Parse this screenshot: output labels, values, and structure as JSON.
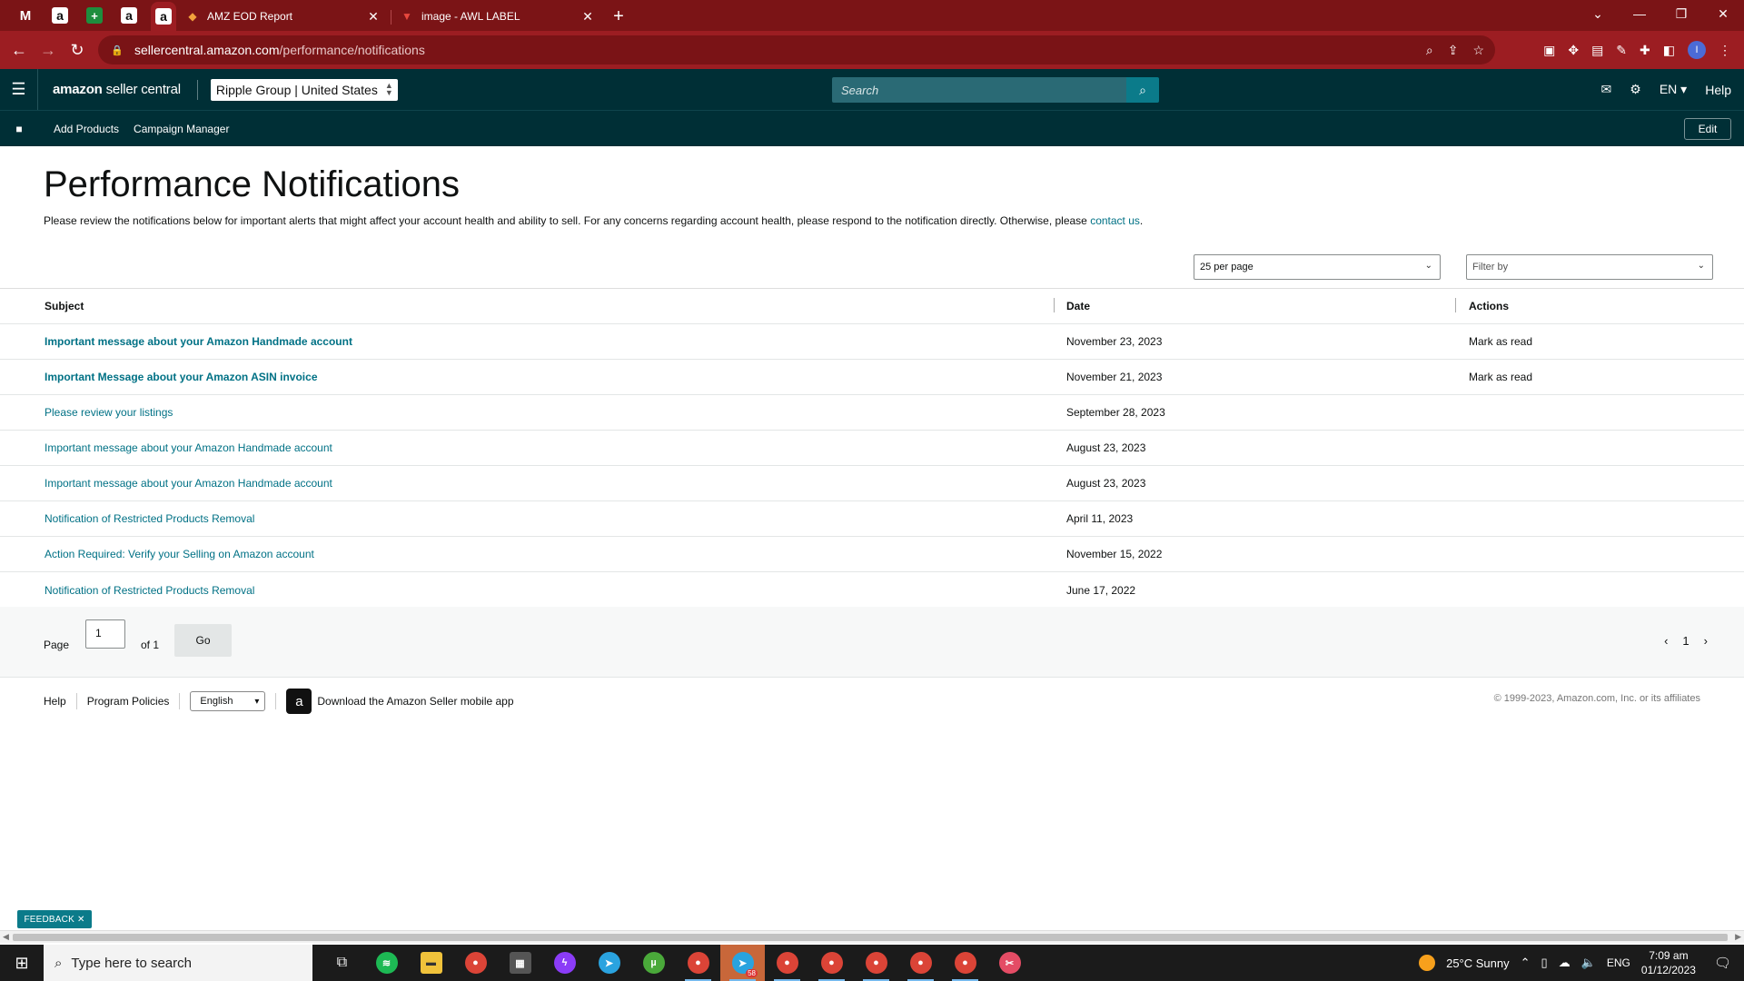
{
  "browser": {
    "pinned_tabs": [
      "gmail",
      "amazon",
      "sheets",
      "amazon",
      "amazon"
    ],
    "tabs": [
      {
        "title": "AMZ EOD Report"
      },
      {
        "title": "image - AWL LABEL"
      }
    ],
    "url_host": "sellercentral.amazon.com",
    "url_path": "/performance/notifications"
  },
  "header": {
    "logo_brand": "amazon",
    "logo_product": "seller central",
    "account": "Ripple Group",
    "marketplace": "United States",
    "search_placeholder": "Search",
    "language": "EN",
    "help": "Help"
  },
  "bookmarks": {
    "items": [
      "Add Products",
      "Campaign Manager"
    ],
    "edit": "Edit"
  },
  "page": {
    "title": "Performance Notifications",
    "intro": "Please review the notifications below for important alerts that might affect your account health and ability to sell. For any concerns regarding account health, please respond to the notification directly. Otherwise, please ",
    "intro_link": "contact us",
    "intro_end": ".",
    "per_page": "25 per page",
    "filter_placeholder": "Filter by"
  },
  "table": {
    "headers": {
      "subject": "Subject",
      "date": "Date",
      "actions": "Actions"
    },
    "rows": [
      {
        "subject": "Important message about your Amazon Handmade account",
        "date": "November 23, 2023",
        "action": "Mark as read"
      },
      {
        "subject": "Important Message about your Amazon ASIN invoice",
        "date": "November 21, 2023",
        "action": "Mark as read"
      },
      {
        "subject": "Please review your listings",
        "date": "September 28, 2023",
        "action": ""
      },
      {
        "subject": "Important message about your Amazon Handmade account",
        "date": "August 23, 2023",
        "action": ""
      },
      {
        "subject": "Important message about your Amazon Handmade account",
        "date": "August 23, 2023",
        "action": ""
      },
      {
        "subject": "Notification of Restricted Products Removal",
        "date": "April 11, 2023",
        "action": ""
      },
      {
        "subject": "Action Required: Verify your Selling on Amazon account",
        "date": "November 15, 2022",
        "action": ""
      },
      {
        "subject": "Notification of Restricted Products Removal",
        "date": "June 17, 2022",
        "action": ""
      }
    ]
  },
  "pagination": {
    "page_label": "Page",
    "page_value": "1",
    "of_label": "of 1",
    "go": "Go",
    "current": "1"
  },
  "footer": {
    "help": "Help",
    "policies": "Program Policies",
    "language": "English",
    "app": "Download the Amazon Seller mobile app",
    "copyright": "© 1999-2023, Amazon.com, Inc. or its affiliates"
  },
  "feedback": "FEEDBACK",
  "taskbar": {
    "search": "Type here to search",
    "telegram_badge": "58",
    "weather": "25°C  Sunny",
    "lang": "ENG",
    "time": "7:09 am",
    "date": "01/12/2023"
  },
  "colors": {
    "browser_frame": "#7b1416",
    "header_bg": "#002f36",
    "link": "#007185",
    "search_button": "#0b7b8a"
  }
}
